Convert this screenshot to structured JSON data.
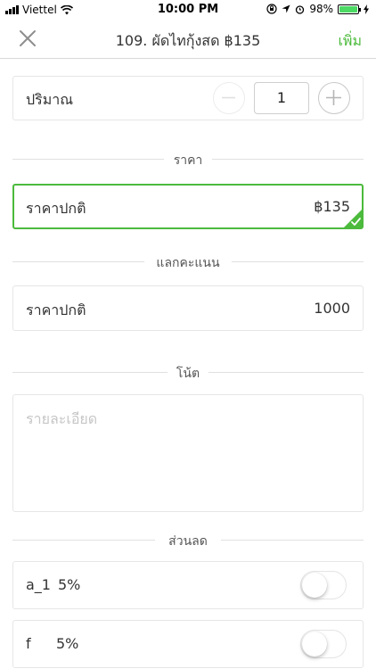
{
  "status_bar": {
    "carrier": "Viettel",
    "time": "10:00 PM",
    "battery": "98%",
    "battery_level": 0.98
  },
  "navbar": {
    "title": "109. ผัดไทกุ้งสด ฿135",
    "add_label": "เพิ่ม"
  },
  "quantity": {
    "label": "ปริมาณ",
    "value": "1"
  },
  "price_section": {
    "header": "ราคา",
    "option": {
      "label": "ราคาปกติ",
      "value": "฿135",
      "selected": true
    }
  },
  "points_section": {
    "header": "แลกคะแนน",
    "option": {
      "label": "ราคาปกติ",
      "value": "1000"
    }
  },
  "note_section": {
    "header": "โน้ต",
    "placeholder": "รายละเอียด"
  },
  "discount_section": {
    "header": "ส่วนลด",
    "items": [
      {
        "name": "a_1",
        "percent": "5%",
        "enabled": false
      },
      {
        "name": "f",
        "percent": "5%",
        "enabled": false
      }
    ]
  },
  "colors": {
    "accent": "#4cba3c",
    "border": "#e6e6e6",
    "placeholder": "#c6c6c6"
  }
}
